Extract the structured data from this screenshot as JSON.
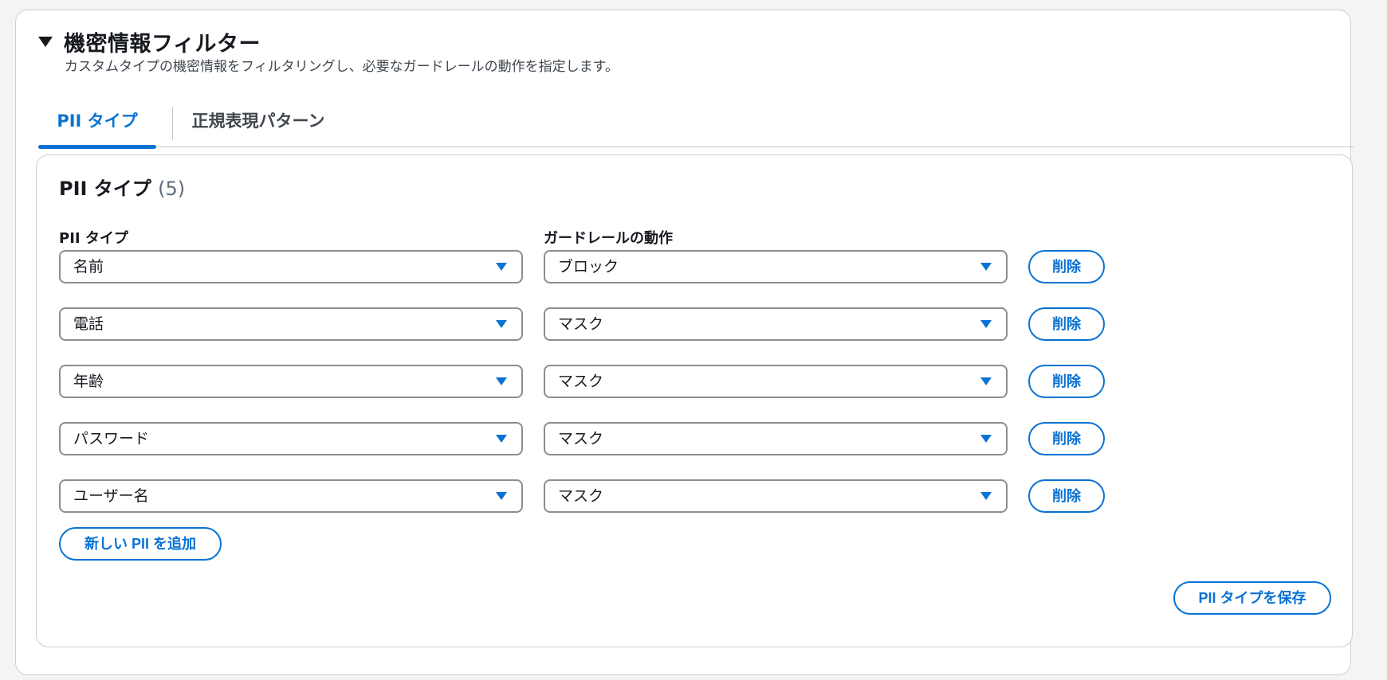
{
  "section": {
    "title": "機密情報フィルター",
    "description": "カスタムタイプの機密情報をフィルタリングし、必要なガードレールの動作を指定します。"
  },
  "tabs": [
    {
      "label": "PII タイプ",
      "active": true
    },
    {
      "label": "正規表現パターン",
      "active": false
    }
  ],
  "pii_panel": {
    "title": "PII タイプ",
    "count": "(5)",
    "column_pii_label": "PII タイプ",
    "column_action_label": "ガードレールの動作",
    "rows": [
      {
        "pii_type": "名前",
        "action": "ブロック",
        "delete_label": "削除"
      },
      {
        "pii_type": "電話",
        "action": "マスク",
        "delete_label": "削除"
      },
      {
        "pii_type": "年齢",
        "action": "マスク",
        "delete_label": "削除"
      },
      {
        "pii_type": "パスワード",
        "action": "マスク",
        "delete_label": "削除"
      },
      {
        "pii_type": "ユーザー名",
        "action": "マスク",
        "delete_label": "削除"
      }
    ],
    "add_label": "新しい PII を追加",
    "save_label": "PII タイプを保存"
  },
  "colors": {
    "accent": "#0972d3",
    "text": "#16191f",
    "muted": "#5f6b7a",
    "border": "#8c8c94"
  },
  "icons": {
    "section_toggle": "caret-down-icon",
    "select_indicator": "dropdown-arrow-icon"
  }
}
